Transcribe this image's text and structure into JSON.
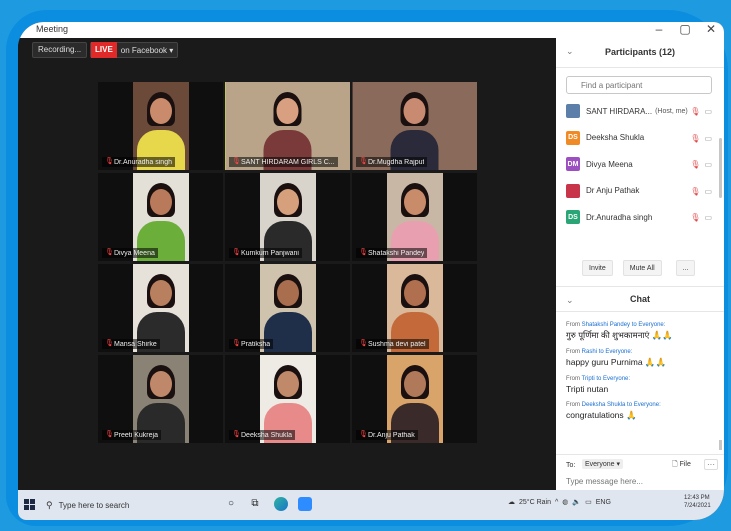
{
  "window": {
    "title": "Meeting",
    "minimize": "–",
    "maximize": "▢",
    "close": "✕"
  },
  "topbar": {
    "recording": "Recording...",
    "live_badge": "LIVE",
    "live_text": "on Facebook ▾"
  },
  "tiles": [
    {
      "name": "Dr.Anuradha singh",
      "bg": "#6b4a3a",
      "skin": "#c98b6b",
      "top": "#e6d84a",
      "wide": false,
      "active": false
    },
    {
      "name": "SANT HIRDARAM GIRLS C...",
      "bg": "#b9a48a",
      "skin": "#d8a080",
      "top": "#7a3a3a",
      "wide": true,
      "active": true
    },
    {
      "name": "Dr.Mugdha Rajput",
      "bg": "#8a6a5a",
      "skin": "#c88a70",
      "top": "#2a2a3a",
      "wide": true,
      "active": false
    },
    {
      "name": "Divya Meena",
      "bg": "#e3e0d8",
      "skin": "#b87a5a",
      "top": "#6cae3a",
      "wide": false,
      "active": false
    },
    {
      "name": "Kumkum Panjwani",
      "bg": "#d8d4cc",
      "skin": "#d6a07c",
      "top": "#2a2a2a",
      "wide": false,
      "active": false
    },
    {
      "name": "Shatakshi Pandey",
      "bg": "#c9b7a5",
      "skin": "#c88c6a",
      "top": "#e8a0b0",
      "wide": false,
      "active": false
    },
    {
      "name": "Mansa Shirke",
      "bg": "#e6e2da",
      "skin": "#b8805e",
      "top": "#2b2b2b",
      "wide": false,
      "active": false
    },
    {
      "name": "Pratiksha",
      "bg": "#cfc3ae",
      "skin": "#a86e4e",
      "top": "#1f2f4a",
      "wide": false,
      "active": false
    },
    {
      "name": "Sushma devi patel",
      "bg": "#d9b99a",
      "skin": "#b07050",
      "top": "#c46a3a",
      "wide": false,
      "active": false
    },
    {
      "name": "Preeti Kukreja",
      "bg": "#8a8275",
      "skin": "#c0886a",
      "top": "#2a2a2a",
      "wide": false,
      "active": false
    },
    {
      "name": "Deeksha Shukla",
      "bg": "#eeeae4",
      "skin": "#c08a6a",
      "top": "#e88a8a",
      "wide": false,
      "active": false
    },
    {
      "name": "Dr.Anju Pathak",
      "bg": "#d8a46a",
      "skin": "#b07a5a",
      "top": "#3a2a2a",
      "wide": false,
      "active": false
    }
  ],
  "participants": {
    "chevron": "⌄",
    "title": "Participants (12)",
    "search_placeholder": "Find a participant",
    "items": [
      {
        "initials": "",
        "name": "SANT HIRDARA...",
        "role": "(Host, me)",
        "color": "#5b7fa8"
      },
      {
        "initials": "DS",
        "name": "Deeksha Shukla",
        "role": "",
        "color": "#f08a24"
      },
      {
        "initials": "DM",
        "name": "Divya Meena",
        "role": "",
        "color": "#9b4fc0"
      },
      {
        "initials": "",
        "name": "Dr Anju Pathak",
        "role": "",
        "color": "#c8344a"
      },
      {
        "initials": "DS",
        "name": "Dr.Anuradha singh",
        "role": "",
        "color": "#2aa676"
      }
    ],
    "invite": "Invite",
    "mute_all": "Mute All",
    "more": "..."
  },
  "chat": {
    "chevron": "⌄",
    "title": "Chat",
    "messages": [
      {
        "from": "Shatakshi Pandey",
        "to": "Everyone:",
        "text": "गुरु पूर्णिमा की शुभकामनाएं 🙏🙏"
      },
      {
        "from": "Rashi",
        "to": "Everyone:",
        "text": "happy guru Purnima 🙏🙏"
      },
      {
        "from": "Tripti",
        "to": "Everyone:",
        "text": "Tripti nutan"
      },
      {
        "from": "Deeksha Shukla",
        "to": "Everyone:",
        "text": "congratulations 🙏"
      }
    ],
    "from_word": "From",
    "to_word": "to",
    "to_label": "To:",
    "to_select": "Everyone ▾",
    "file": "File",
    "more": "···",
    "input_placeholder": "Type message here..."
  },
  "taskbar": {
    "search_placeholder": "Type here to search",
    "weather": "25°C  Rain",
    "lang": "ENG",
    "time": "12:43 PM",
    "date": "7/24/2021"
  }
}
